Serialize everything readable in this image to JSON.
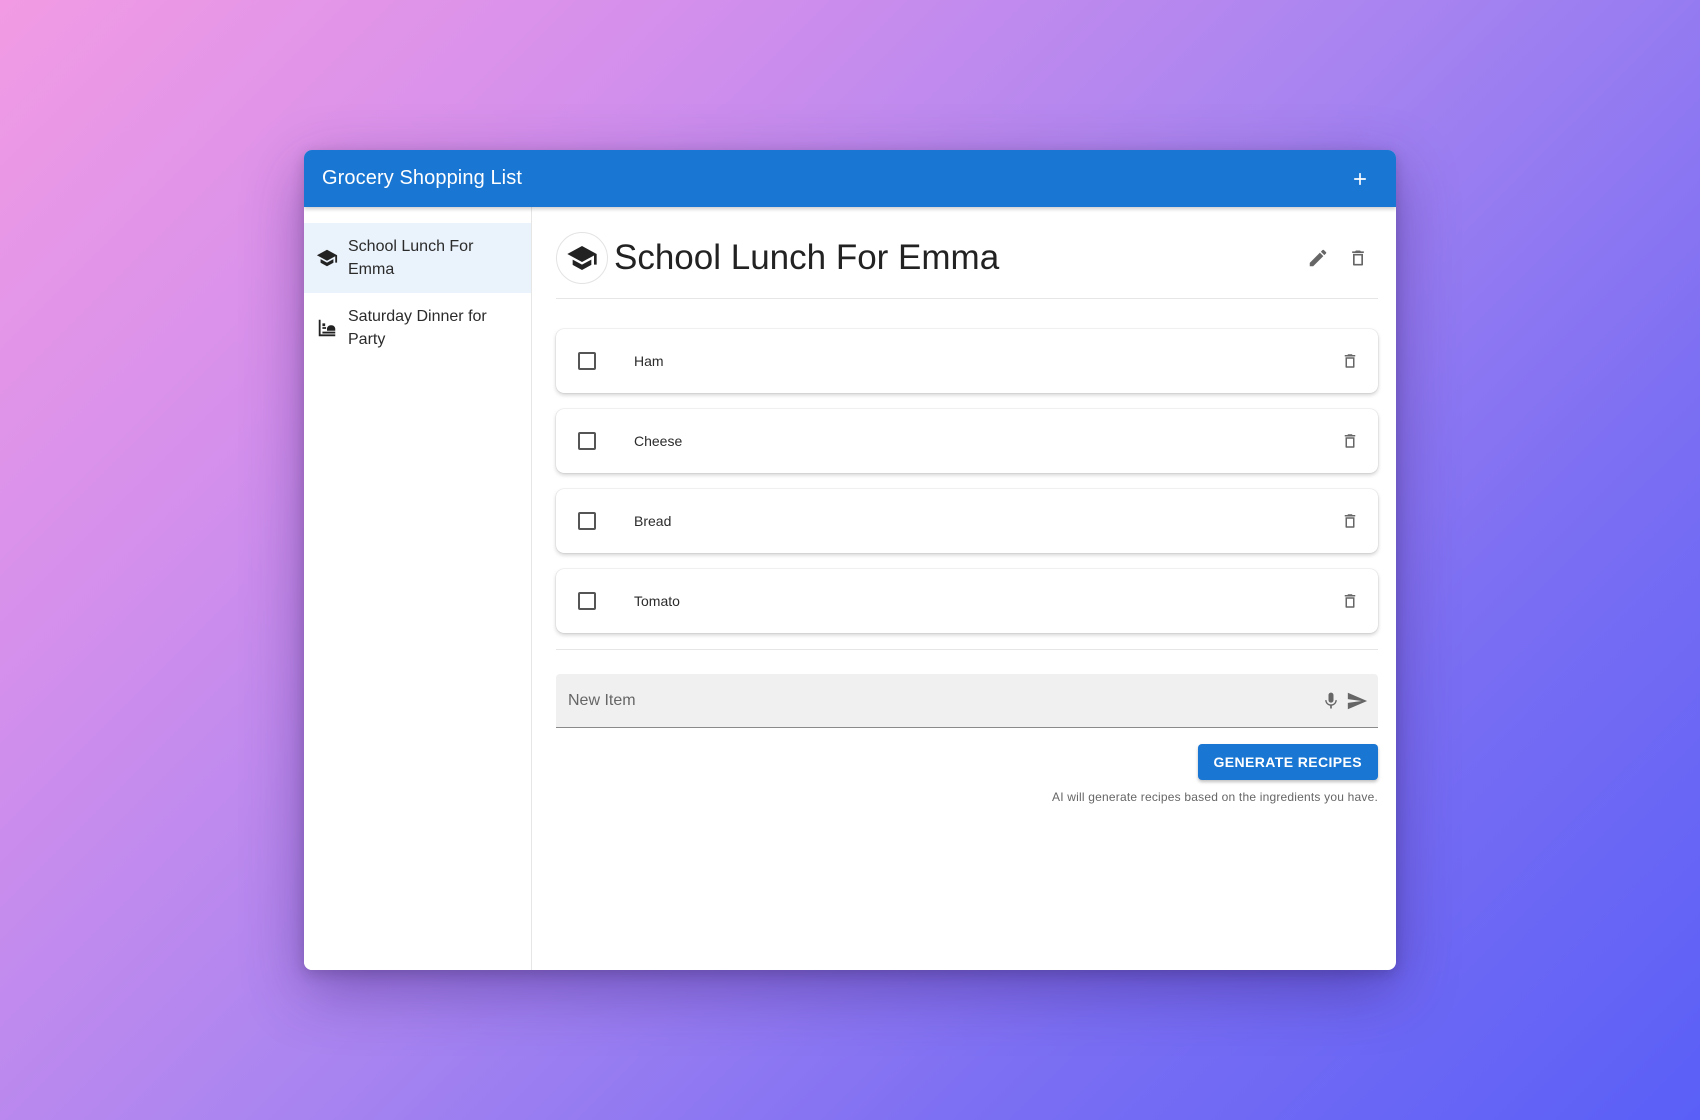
{
  "appbar": {
    "title": "Grocery Shopping List",
    "add_icon": "plus-icon"
  },
  "sidebar": {
    "items": [
      {
        "label": "School Lunch For Emma",
        "icon": "school-cap-icon",
        "active": true
      },
      {
        "label": "Saturday Dinner for Party",
        "icon": "dinner-icon",
        "active": false
      }
    ]
  },
  "main": {
    "title": "School Lunch For Emma",
    "avatar_icon": "school-cap-icon",
    "items": [
      {
        "label": "Ham",
        "checked": false
      },
      {
        "label": "Cheese",
        "checked": false
      },
      {
        "label": "Bread",
        "checked": false
      },
      {
        "label": "Tomato",
        "checked": false
      }
    ],
    "new_item_placeholder": "New Item",
    "generate_label": "GENERATE RECIPES",
    "hint": "AI will generate recipes based on the ingredients you have."
  },
  "colors": {
    "primary": "#1976d2",
    "selected_bg": "#eaf2fb"
  }
}
